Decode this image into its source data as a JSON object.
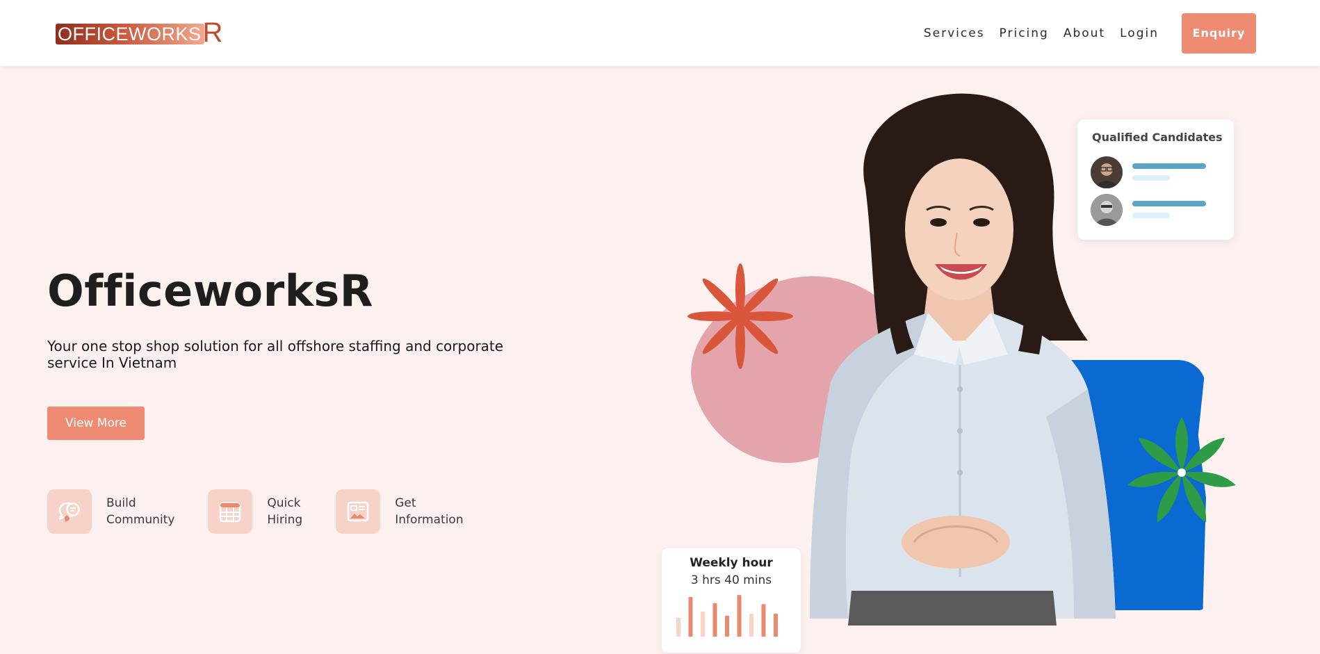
{
  "header": {
    "logo_text": "OFFICEWORKS",
    "logo_r": "R",
    "nav": [
      "Services",
      "Pricing",
      "About",
      "Login"
    ],
    "enquiry_label": "Enquiry"
  },
  "hero": {
    "title": "OfficeworksR",
    "subtitle": "Your one stop shop solution for all offshore staffing and corporate service In Vietnam",
    "cta_label": "View More",
    "features": [
      {
        "label": "Build\nCommunity",
        "icon": "chat-bubble-icon"
      },
      {
        "label": "Quick\nHiring",
        "icon": "calendar-icon"
      },
      {
        "label": "Get\nInformation",
        "icon": "image-card-icon"
      }
    ]
  },
  "candidates_card": {
    "title": "Qualified Candidates"
  },
  "weekly_card": {
    "title": "Weekly hour",
    "value": "3 hrs 40 mins",
    "bars": [
      0.45,
      0.95,
      0.6,
      0.8,
      0.5,
      1.0,
      0.55,
      0.78,
      0.55
    ],
    "bar_colors": [
      "#f7d4c6",
      "#e98a6f",
      "#f7d4c6",
      "#e98a6f",
      "#e98a6f",
      "#e98a6f",
      "#f7d4c6",
      "#e98a6f",
      "#e98a6f"
    ]
  },
  "colors": {
    "accent": "#ef8b72",
    "background": "#fcf1ef",
    "blue": "#0b6ad2",
    "green": "#2e9b47",
    "orange_star": "#d9563a",
    "pink_blob": "#e3a4ab"
  }
}
